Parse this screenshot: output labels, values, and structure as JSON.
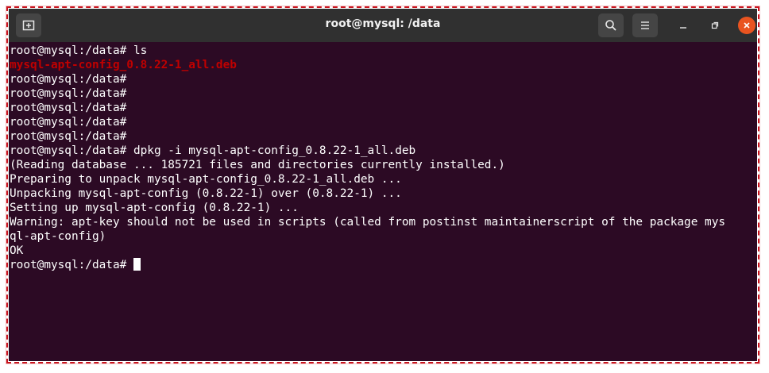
{
  "window": {
    "title": "root@mysql: /data"
  },
  "icons": {
    "new_tab": "new-tab-icon",
    "search": "search-icon",
    "menu": "hamburger-menu-icon",
    "minimize": "minimize-icon",
    "maximize": "maximize-icon",
    "close": "close-icon"
  },
  "colors": {
    "terminal_bg": "#2c0a24",
    "titlebar_bg": "#303030",
    "deb_file": "#c00000",
    "close_button": "#e95420",
    "frame_border": "#c8141e"
  },
  "terminal": {
    "lines": [
      {
        "prompt": "root@mysql:/data#",
        "cmd": " ls"
      },
      {
        "highlight": "mysql-apt-config_0.8.22-1_all.deb"
      },
      {
        "prompt": "root@mysql:/data#",
        "cmd": ""
      },
      {
        "prompt": "root@mysql:/data#",
        "cmd": ""
      },
      {
        "prompt": "root@mysql:/data#",
        "cmd": ""
      },
      {
        "prompt": "root@mysql:/data#",
        "cmd": ""
      },
      {
        "prompt": "root@mysql:/data#",
        "cmd": ""
      },
      {
        "prompt": "root@mysql:/data#",
        "cmd": " dpkg -i mysql-apt-config_0.8.22-1_all.deb"
      },
      {
        "text": "(Reading database ... 185721 files and directories currently installed.)"
      },
      {
        "text": "Preparing to unpack mysql-apt-config_0.8.22-1_all.deb ..."
      },
      {
        "text": "Unpacking mysql-apt-config (0.8.22-1) over (0.8.22-1) ..."
      },
      {
        "text": "Setting up mysql-apt-config (0.8.22-1) ..."
      },
      {
        "text": "Warning: apt-key should not be used in scripts (called from postinst maintainerscript of the package mys"
      },
      {
        "text": "ql-apt-config)"
      },
      {
        "text": "OK"
      },
      {
        "prompt": "root@mysql:/data#",
        "cmd": " ",
        "cursor": true
      }
    ]
  }
}
